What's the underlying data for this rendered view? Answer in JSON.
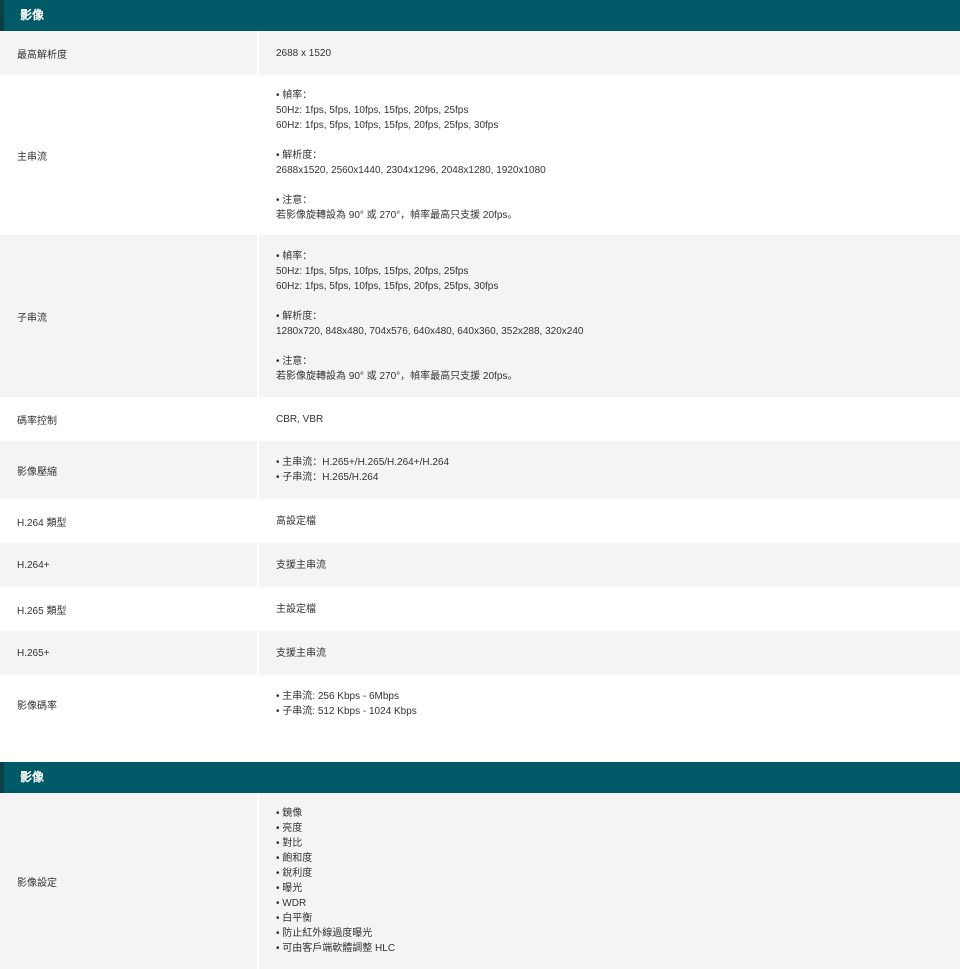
{
  "section1": {
    "title": "影像",
    "rows": [
      {
        "label": "最高解析度",
        "lines": [
          "2688 x 1520"
        ]
      },
      {
        "label": "主串流",
        "lines": [
          "• 幀率：",
          "50Hz: 1fps, 5fps, 10fps, 15fps, 20fps, 25fps",
          "60Hz: 1fps, 5fps, 10fps, 15fps, 20fps, 25fps, 30fps",
          "",
          "• 解析度：",
          "2688x1520, 2560x1440, 2304x1296, 2048x1280, 1920x1080",
          "",
          "• 注意：",
          "若影像旋轉設為 90° 或 270°，幀率最高只支援 20fps。"
        ]
      },
      {
        "label": "子串流",
        "lines": [
          "• 幀率：",
          "50Hz: 1fps, 5fps, 10fps, 15fps, 20fps, 25fps",
          "60Hz: 1fps, 5fps, 10fps, 15fps, 20fps, 25fps, 30fps",
          "",
          "• 解析度：",
          "1280x720, 848x480, 704x576, 640x480, 640x360, 352x288, 320x240",
          "",
          "• 注意：",
          "若影像旋轉設為 90° 或 270°，幀率最高只支援 20fps。"
        ]
      },
      {
        "label": "碼率控制",
        "lines": [
          "CBR, VBR"
        ]
      },
      {
        "label": "影像壓縮",
        "lines": [
          "• 主串流：H.265+/H.265/H.264+/H.264",
          "• 子串流：H.265/H.264"
        ]
      },
      {
        "label": "H.264 類型",
        "lines": [
          "高設定檔"
        ]
      },
      {
        "label": "H.264+",
        "lines": [
          "支援主串流"
        ]
      },
      {
        "label": "H.265 類型",
        "lines": [
          "主設定檔"
        ]
      },
      {
        "label": "H.265+",
        "lines": [
          "支援主串流"
        ]
      },
      {
        "label": "影像碼率",
        "lines": [
          "• 主串流: 256 Kbps - 6Mbps",
          "• 子串流: 512 Kbps - 1024 Kbps"
        ]
      }
    ]
  },
  "section2": {
    "title": "影像",
    "rows": [
      {
        "label": "影像設定",
        "lines": [
          "• 鏡像",
          "• 亮度",
          "• 對比",
          "• 飽和度",
          "• 銳利度",
          "• 曝光",
          "• WDR",
          "• 白平衡",
          "• 防止紅外線過度曝光",
          "• 可由客戶端軟體調整 HLC"
        ]
      }
    ]
  }
}
